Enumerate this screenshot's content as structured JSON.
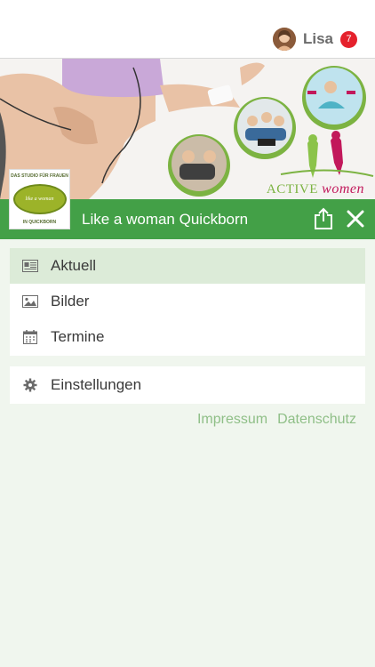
{
  "user": {
    "name": "Lisa",
    "notifications": "7"
  },
  "hero": {
    "brand_prefix": "ACTIVE",
    "brand_suffix": "women"
  },
  "logo": {
    "top_text": "DAS STUDIO FÜR FRAUEN",
    "center_text": "like a woman",
    "bottom_text": "IN QUICKBORN"
  },
  "header": {
    "title": "Like a woman Quickborn"
  },
  "menu": {
    "items": [
      {
        "label": "Aktuell",
        "icon": "newspaper-icon",
        "active": true
      },
      {
        "label": "Bilder",
        "icon": "image-icon",
        "active": false
      },
      {
        "label": "Termine",
        "icon": "calendar-icon",
        "active": false
      }
    ],
    "settings_label": "Einstellungen"
  },
  "footer": {
    "impressum": "Impressum",
    "datenschutz": "Datenschutz"
  },
  "colors": {
    "accent_green": "#43a047",
    "background": "#f0f6ee",
    "active_item": "#dcebd8",
    "link_green": "#8fbf87",
    "badge_red": "#e5212c"
  }
}
